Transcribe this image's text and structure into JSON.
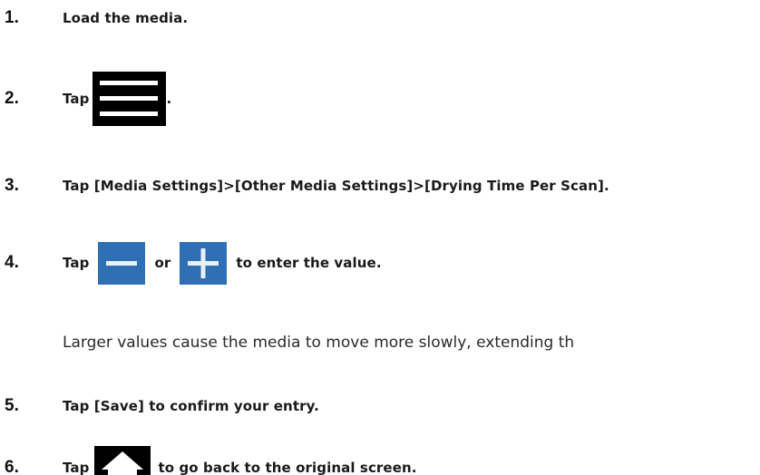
{
  "steps": [
    {
      "number": "1.",
      "text": "Load the media."
    },
    {
      "number": "2.",
      "text_before": "Tap",
      "text_after": ".",
      "icon": "menu-icon"
    },
    {
      "number": "3.",
      "text": "Tap [Media Settings]>[Other Media Settings]>[Drying Time Per Scan]."
    },
    {
      "number": "4.",
      "text_before": "Tap",
      "text_middle": "or",
      "text_after": "to enter the value.",
      "icons": [
        "minus-icon",
        "plus-icon"
      ]
    },
    {
      "number": "5.",
      "text": "Tap [Save] to confirm your entry."
    },
    {
      "number": "6.",
      "text_before": "Tap",
      "text_after": "to go back to the original screen.",
      "icon": "home-icon"
    }
  ],
  "note": "Larger values cause the media to move more slowly, extending th",
  "colors": {
    "blue_button": "#2f6fb3",
    "dark_button": "#000000"
  }
}
